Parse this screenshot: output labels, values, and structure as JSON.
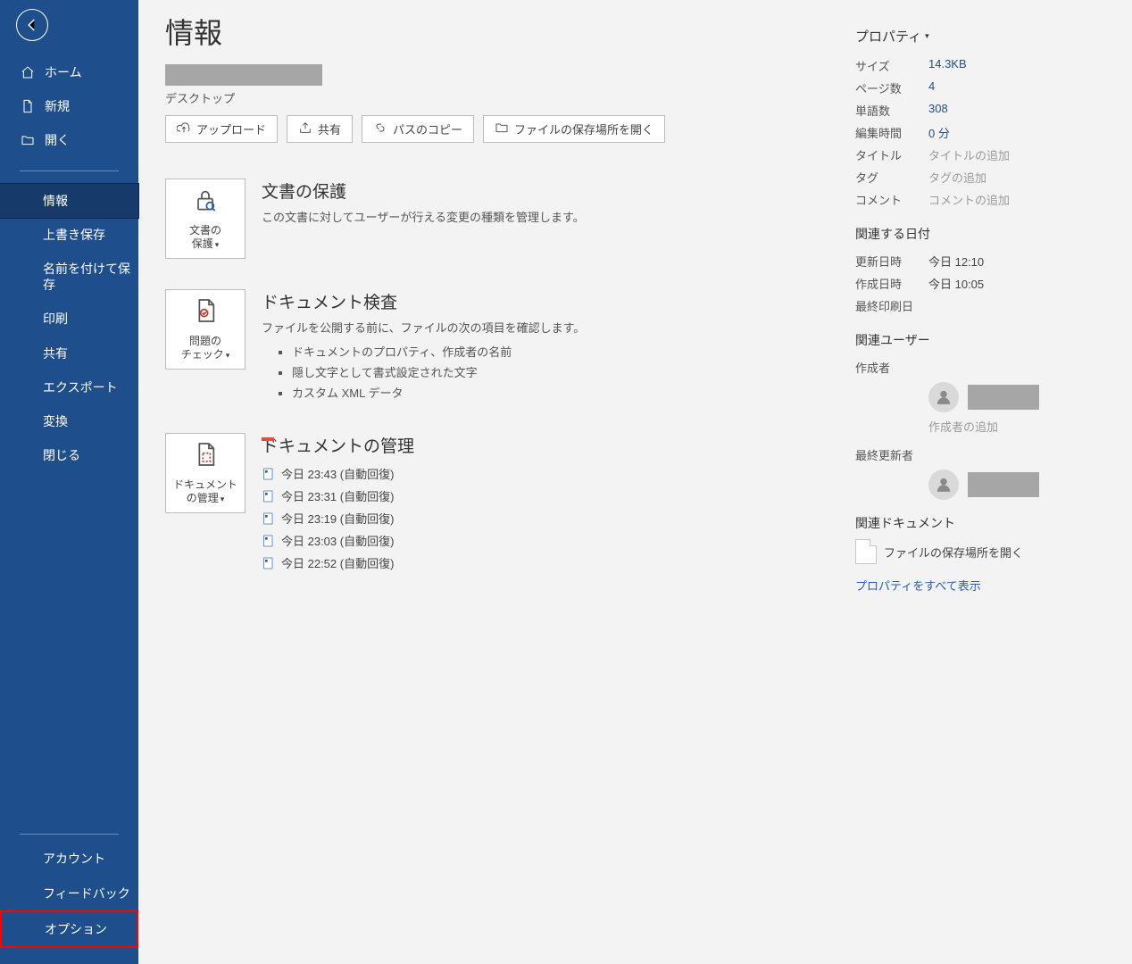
{
  "sidebar": {
    "home": "ホーム",
    "new": "新規",
    "open": "開く",
    "info": "情報",
    "save": "上書き保存",
    "save_as": "名前を付けて保存",
    "print": "印刷",
    "share": "共有",
    "export": "エクスポート",
    "transform": "変換",
    "close": "閉じる",
    "account": "アカウント",
    "feedback": "フィードバック",
    "options": "オプション"
  },
  "header": {
    "title": "情報",
    "location": "デスクトップ"
  },
  "actions": {
    "upload": "アップロード",
    "share": "共有",
    "copy_path": "パスのコピー",
    "open_location": "ファイルの保存場所を開く"
  },
  "protect": {
    "button_line1": "文書の",
    "button_line2": "保護",
    "title": "文書の保護",
    "desc": "この文書に対してユーザーが行える変更の種類を管理します。"
  },
  "inspect": {
    "button_line1": "問題の",
    "button_line2": "チェック",
    "title": "ドキュメント検査",
    "desc": "ファイルを公開する前に、ファイルの次の項目を確認します。",
    "items": [
      "ドキュメントのプロパティ、作成者の名前",
      "隠し文字として書式設定された文字",
      "カスタム XML データ"
    ]
  },
  "manage": {
    "button_line1": "ドキュメント",
    "button_line2": "の管理",
    "title": "ドキュメントの管理",
    "versions": [
      "今日 23:43 (自動回復)",
      "今日 23:31 (自動回復)",
      "今日 23:19 (自動回復)",
      "今日 23:03 (自動回復)",
      "今日 22:52 (自動回復)"
    ]
  },
  "props": {
    "heading": "プロパティ",
    "labels": {
      "size": "サイズ",
      "pages": "ページ数",
      "words": "単語数",
      "edit_time": "編集時間",
      "title": "タイトル",
      "tag": "タグ",
      "comment": "コメント"
    },
    "values": {
      "size": "14.3KB",
      "pages": "4",
      "words": "308",
      "edit_time": "0 分",
      "title_ph": "タイトルの追加",
      "tag_ph": "タグの追加",
      "comment_ph": "コメントの追加"
    },
    "dates_heading": "関連する日付",
    "date_labels": {
      "modified": "更新日時",
      "created": "作成日時",
      "printed": "最終印刷日"
    },
    "date_values": {
      "modified": "今日 12:10",
      "created": "今日 10:05",
      "printed": ""
    },
    "users_heading": "関連ユーザー",
    "user_labels": {
      "author": "作成者",
      "last_modified_by": "最終更新者"
    },
    "add_author": "作成者の追加",
    "docs_heading": "関連ドキュメント",
    "open_location": "ファイルの保存場所を開く",
    "show_all": "プロパティをすべて表示"
  }
}
